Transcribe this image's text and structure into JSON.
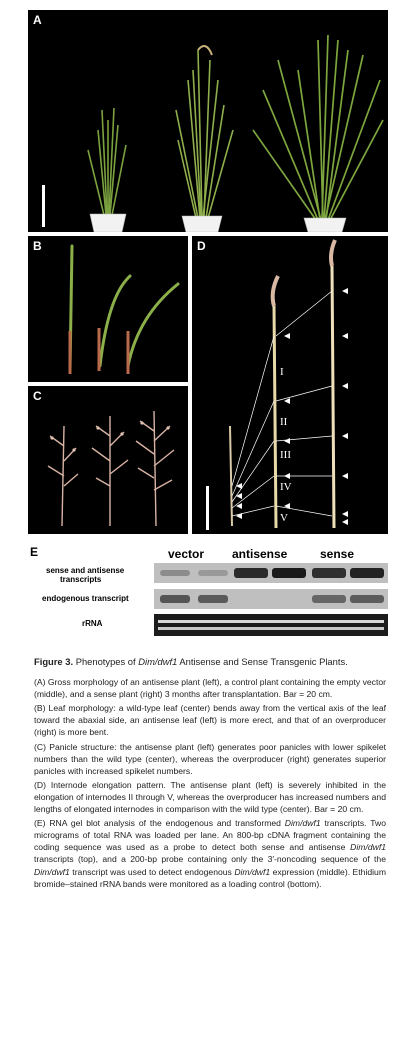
{
  "figure": {
    "panel_labels": {
      "a": "A",
      "b": "B",
      "c": "C",
      "d": "D",
      "e": "E"
    },
    "internode_labels": [
      "I",
      "II",
      "III",
      "IV",
      "V"
    ]
  },
  "blot": {
    "lanes": [
      "vector",
      "antisense",
      "sense"
    ],
    "rows": {
      "sense_antisense": [
        "sense and antisense",
        "transcripts"
      ],
      "endogenous": "endogenous transcript",
      "rrna": "rRNA"
    }
  },
  "caption": {
    "title_prefix": "Figure 3.",
    "title_parts": [
      "Phenotypes of ",
      "Dim/dwf1",
      " Antisense and Sense Transgenic Plants."
    ],
    "a": "(A) Gross morphology of an antisense plant (left), a control plant containing the empty vector (middle), and a sense plant (right) 3 months after transplantation. Bar = 20 cm.",
    "b": "(B) Leaf morphology: a wild-type leaf (center) bends away from the vertical axis of the leaf toward the abaxial side, an antisense leaf (left) is more erect, and that of an overproducer (right) is more bent.",
    "c": "(C) Panicle structure: the antisense plant (left) generates poor panicles with lower spikelet numbers than the wild type (center), whereas the overproducer (right) generates superior panicles with increased spikelet numbers.",
    "d": "(D) Internode elongation pattern. The antisense plant (left) is severely inhibited in the elongation of internodes II through V, whereas the overproducer has increased numbers and lengths of elongated internodes in comparison with the wild type (center). Bar = 20 cm.",
    "e_parts": [
      "(E) RNA gel blot analysis of the endogenous and transformed ",
      "Dim/dwf1",
      " transcripts. Two micrograms of total RNA was loaded per lane. An 800-bp cDNA fragment containing the coding sequence was used as a probe to detect both sense and antisense ",
      "Dim/dwf1",
      " transcripts (top), and a 200-bp probe containing only the 3′-noncoding sequence of the ",
      "Dim/dwf1",
      " transcript was used to detect endogenous ",
      "Dim/dwf1",
      " expression (middle). Ethidium bromide–stained rRNA bands were monitored as a loading control (bottom)."
    ]
  },
  "colors": {
    "panel_bg": "#000000",
    "plant_green": "#6e9a3a",
    "stem": "#e8d9a8",
    "panicle": "#d9b9a4"
  }
}
